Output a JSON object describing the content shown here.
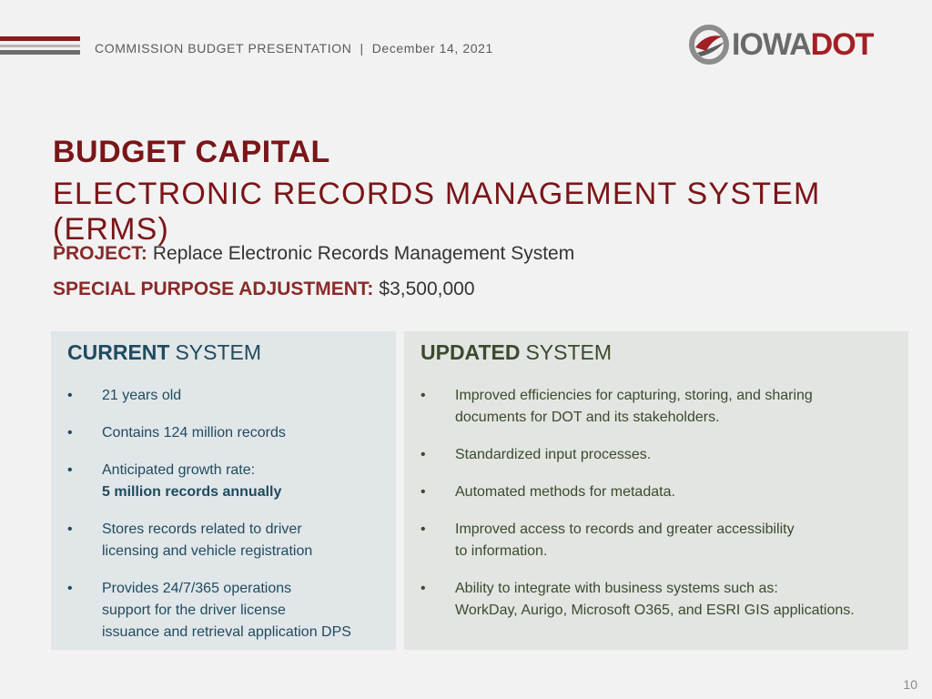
{
  "header": {
    "presentation": "COMMISSION BUDGET PRESENTATION",
    "separator": "|",
    "date": "December 14, 2021",
    "logo_word_1": "IOWA",
    "logo_word_2": "DOT",
    "logo_colors": {
      "gray": "#6a6a6a",
      "red": "#a31f24"
    }
  },
  "title": {
    "line1": "BUDGET CAPITAL",
    "line2": "ELECTRONIC RECORDS MANAGEMENT SYSTEM (ERMS)"
  },
  "project": {
    "label": "PROJECT:",
    "value": "Replace Electronic Records Management System"
  },
  "adjustment": {
    "label": "SPECIAL PURPOSE ADJUSTMENT:",
    "value": "$3,500,000"
  },
  "current_system": {
    "heading_strong": "CURRENT",
    "heading_rest": "SYSTEM",
    "bullet_symbol": "•",
    "items": [
      {
        "line1": "21 years old"
      },
      {
        "line1": "Contains 124 million records"
      },
      {
        "line1": "Anticipated growth rate:",
        "line2": "5 million records annually"
      },
      {
        "line1": "Stores records related to driver",
        "line2": "licensing and vehicle registration"
      },
      {
        "line1": "Provides 24/7/365 operations",
        "line2": "support for the driver license",
        "line3": "issuance and retrieval application DPS"
      }
    ]
  },
  "updated_system": {
    "heading_strong": "UPDATED",
    "heading_rest": "SYSTEM",
    "bullet_symbol": "•",
    "items": [
      {
        "line1": "Improved efficiencies for capturing, storing, and sharing",
        "line2": "documents for DOT and its stakeholders."
      },
      {
        "line1": "Standardized input processes."
      },
      {
        "line1": "Automated methods for metadata."
      },
      {
        "line1": "Improved access to records and greater accessibility",
        "line2": "to information."
      },
      {
        "line1": "Ability to integrate with business systems such as:",
        "line2": "WorkDay, Aurigo, Microsoft O365, and ESRI GIS applications."
      }
    ]
  },
  "page_number": "10"
}
